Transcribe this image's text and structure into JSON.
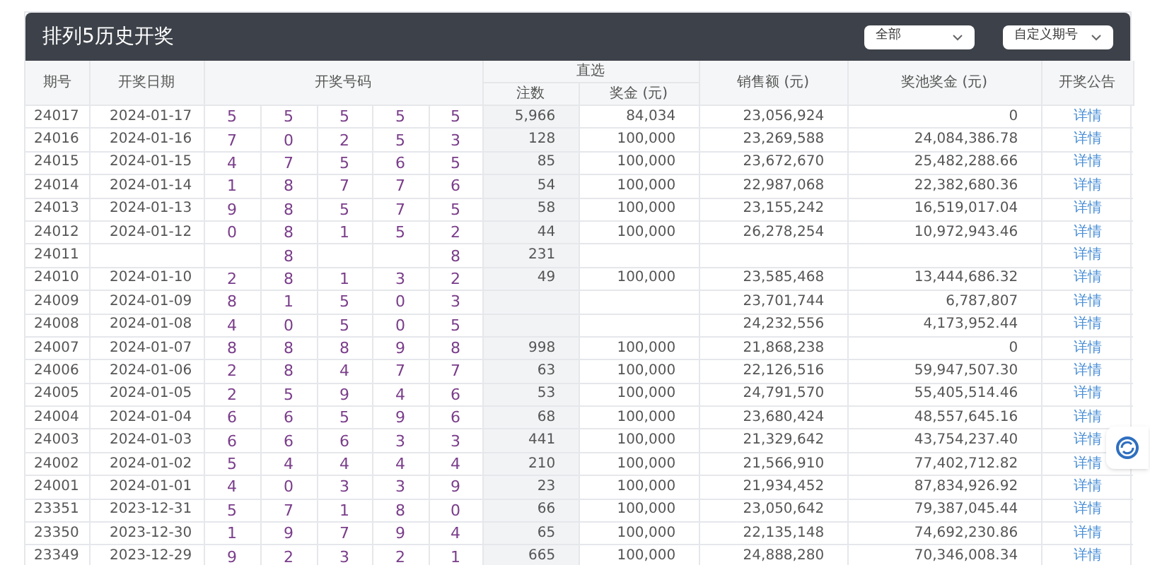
{
  "panel": {
    "title": "排列5历史开奖",
    "filters": [
      {
        "value": "全部"
      },
      {
        "value": "自定义期号"
      }
    ]
  },
  "table": {
    "columns": {
      "period": "期号",
      "date": "开奖日期",
      "numbers": "开奖号码",
      "direct": "直选",
      "count": "注数",
      "prize": "奖金 (元)",
      "sales": "销售额 (元)",
      "pool": "奖池奖金 (元)",
      "notice": "开奖公告"
    },
    "rows": [
      {
        "period": "24017",
        "date": "2024-01-17",
        "numbers": {
          "d1": "5",
          "d2": "5",
          "d3": "5",
          "d4": "5",
          "d5": "5"
        },
        "count": "5,966",
        "prize": "84,034",
        "sales": "23,056,924",
        "pool": "0",
        "link": "详情"
      },
      {
        "period": "24016",
        "date": "2024-01-16",
        "numbers": {
          "d1": "7",
          "d2": "0",
          "d3": "2",
          "d4": "5",
          "d5": "3"
        },
        "count": "128",
        "prize": "100,000",
        "sales": "23,269,588",
        "pool": "24,084,386.78",
        "link": "详情"
      },
      {
        "period": "24015",
        "date": "2024-01-15",
        "numbers": {
          "d1": "4",
          "d2": "7",
          "d3": "5",
          "d4": "6",
          "d5": "5"
        },
        "count": "85",
        "prize": "100,000",
        "sales": "23,672,670",
        "pool": "25,482,288.66",
        "link": "详情"
      },
      {
        "period": "24014",
        "date": "2024-01-14",
        "numbers": {
          "d1": "1",
          "d2": "8",
          "d3": "7",
          "d4": "7",
          "d5": "6"
        },
        "count": "54",
        "prize": "100,000",
        "sales": "22,987,068",
        "pool": "22,382,680.36",
        "link": "详情"
      },
      {
        "period": "24013",
        "date": "2024-01-13",
        "numbers": {
          "d1": "9",
          "d2": "8",
          "d3": "5",
          "d4": "7",
          "d5": "5"
        },
        "count": "58",
        "prize": "100,000",
        "sales": "23,155,242",
        "pool": "16,519,017.04",
        "link": "详情"
      },
      {
        "period": "24012",
        "date": "2024-01-12",
        "numbers": {
          "d1": "0",
          "d2": "8",
          "d3": "1",
          "d4": "5",
          "d5": "2"
        },
        "count": "44",
        "prize": "100,000",
        "sales": "26,278,254",
        "pool": "10,972,943.46",
        "link": "详情"
      },
      {
        "period": "24011",
        "numbers": {
          "d2": "8",
          "d5": "8"
        },
        "count": "231",
        "link": "详情"
      },
      {
        "period": "24010",
        "date": "2024-01-10",
        "numbers": {
          "d1": "2",
          "d2": "8",
          "d3": "1",
          "d4": "3",
          "d5": "2"
        },
        "count": "49",
        "prize": "100,000",
        "sales": "23,585,468",
        "pool": "13,444,686.32",
        "link": "详情"
      },
      {
        "period": "24009",
        "date": "2024-01-09",
        "numbers": {
          "d1": "8",
          "d2": "1",
          "d3": "5",
          "d4": "0",
          "d5": "3"
        },
        "sales": "23,701,744",
        "pool": "6,787,807",
        "link": "详情"
      },
      {
        "period": "24008",
        "date": "2024-01-08",
        "numbers": {
          "d1": "4",
          "d2": "0",
          "d3": "5",
          "d4": "0",
          "d5": "5"
        },
        "sales": "24,232,556",
        "pool": "4,173,952.44",
        "link": "详情"
      },
      {
        "period": "24007",
        "date": "2024-01-07",
        "numbers": {
          "d1": "8",
          "d2": "8",
          "d3": "8",
          "d4": "9",
          "d5": "8"
        },
        "count": "998",
        "prize": "100,000",
        "sales": "21,868,238",
        "pool": "0",
        "link": "详情"
      },
      {
        "period": "24006",
        "date": "2024-01-06",
        "numbers": {
          "d1": "2",
          "d2": "8",
          "d3": "4",
          "d4": "7",
          "d5": "7"
        },
        "count": "63",
        "prize": "100,000",
        "sales": "22,126,516",
        "pool": "59,947,507.30",
        "link": "详情"
      },
      {
        "period": "24005",
        "date": "2024-01-05",
        "numbers": {
          "d1": "2",
          "d2": "5",
          "d3": "9",
          "d4": "4",
          "d5": "6"
        },
        "count": "53",
        "prize": "100,000",
        "sales": "24,791,570",
        "pool": "55,405,514.46",
        "link": "详情"
      },
      {
        "period": "24004",
        "date": "2024-01-04",
        "numbers": {
          "d1": "6",
          "d2": "6",
          "d3": "5",
          "d4": "9",
          "d5": "6"
        },
        "count": "68",
        "prize": "100,000",
        "sales": "23,680,424",
        "pool": "48,557,645.16",
        "link": "详情"
      },
      {
        "period": "24003",
        "date": "2024-01-03",
        "numbers": {
          "d1": "6",
          "d2": "6",
          "d3": "6",
          "d4": "3",
          "d5": "3"
        },
        "count": "441",
        "prize": "100,000",
        "sales": "21,329,642",
        "pool": "43,754,237.40",
        "link": "详情"
      },
      {
        "period": "24002",
        "date": "2024-01-02",
        "numbers": {
          "d1": "5",
          "d2": "4",
          "d3": "4",
          "d4": "4",
          "d5": "4"
        },
        "count": "210",
        "prize": "100,000",
        "sales": "21,566,910",
        "pool": "77,402,712.82",
        "link": "详情"
      },
      {
        "period": "24001",
        "date": "2024-01-01",
        "numbers": {
          "d1": "4",
          "d2": "0",
          "d3": "3",
          "d4": "3",
          "d5": "9"
        },
        "count": "23",
        "prize": "100,000",
        "sales": "21,934,452",
        "pool": "87,834,926.92",
        "link": "详情"
      },
      {
        "period": "23351",
        "date": "2023-12-31",
        "numbers": {
          "d1": "5",
          "d2": "7",
          "d3": "1",
          "d4": "8",
          "d5": "0"
        },
        "count": "66",
        "prize": "100,000",
        "sales": "23,050,642",
        "pool": "79,387,045.44",
        "link": "详情"
      },
      {
        "period": "23350",
        "date": "2023-12-30",
        "numbers": {
          "d1": "1",
          "d2": "9",
          "d3": "7",
          "d4": "9",
          "d5": "4"
        },
        "count": "65",
        "prize": "100,000",
        "sales": "22,135,148",
        "pool": "74,692,230.86",
        "link": "详情"
      },
      {
        "period": "23349",
        "date": "2023-12-29",
        "numbers": {
          "d1": "9",
          "d2": "2",
          "d3": "3",
          "d4": "2",
          "d5": "1"
        },
        "count": "665",
        "prize": "100,000",
        "sales": "24,888,280",
        "pool": "70,346,008.34",
        "link": "详情"
      }
    ]
  }
}
